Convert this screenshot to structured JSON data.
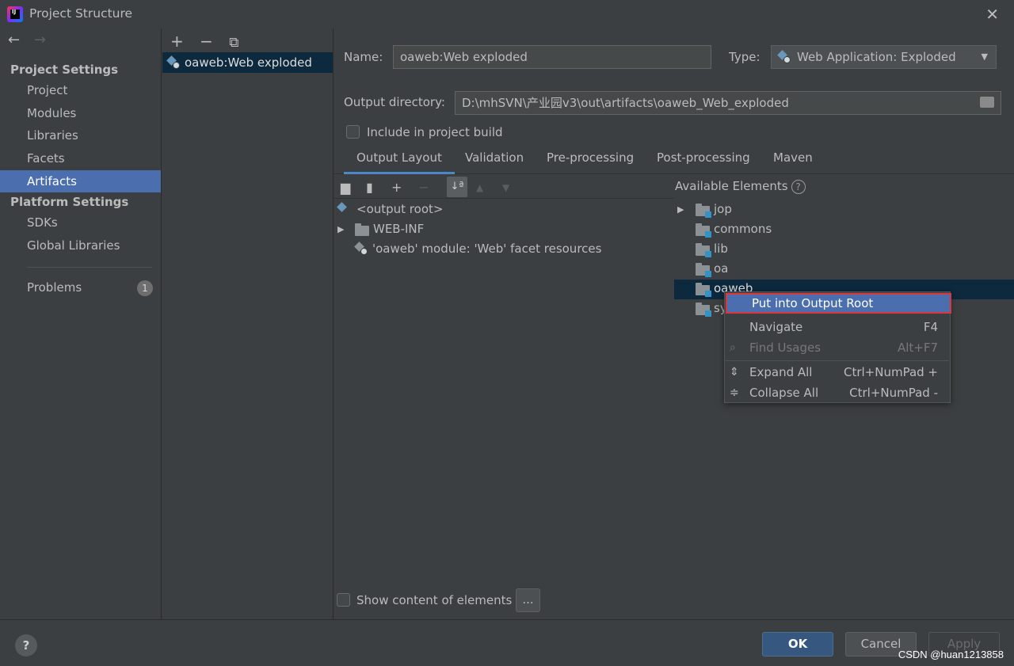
{
  "window": {
    "title": "Project Structure",
    "close": "✕"
  },
  "nav": {
    "back": "←",
    "forward": "→",
    "group_project": "Project Settings",
    "items_project": [
      "Project",
      "Modules",
      "Libraries",
      "Facets",
      "Artifacts"
    ],
    "group_platform": "Platform Settings",
    "items_platform": [
      "SDKs",
      "Global Libraries"
    ],
    "problems": "Problems",
    "problems_count": "1",
    "selected": "Artifacts"
  },
  "artifacts": {
    "toolbar": {
      "add": "+",
      "remove": "−",
      "copy": "⧉"
    },
    "items": [
      "oaweb:Web exploded"
    ]
  },
  "form": {
    "name_label": "Name:",
    "name_value": "oaweb:Web exploded",
    "type_label": "Type:",
    "type_value": "Web Application: Exploded",
    "output_label": "Output directory:",
    "output_value": "D:\\mhSVN\\产业园v3\\out\\artifacts\\oaweb_Web_exploded",
    "include_label": "Include in project build",
    "include_checked": false
  },
  "tabs": [
    "Output Layout",
    "Validation",
    "Pre-processing",
    "Post-processing",
    "Maven"
  ],
  "active_tab": "Output Layout",
  "layout_tree": {
    "rows": [
      "<output root>",
      "WEB-INF",
      "'oaweb' module: 'Web' facet resources"
    ]
  },
  "available": {
    "title": "Available Elements",
    "help": "?",
    "rows": [
      "jop",
      "commons",
      "lib",
      "oa",
      "oaweb",
      "sy"
    ]
  },
  "context_menu": {
    "items": [
      {
        "label": "Put into Output Root",
        "shortcut": ""
      },
      {
        "label": "Navigate",
        "shortcut": "F4"
      },
      {
        "label": "Find Usages",
        "shortcut": "Alt+F7"
      },
      {
        "label": "Expand All",
        "shortcut": "Ctrl+NumPad +"
      },
      {
        "label": "Collapse All",
        "shortcut": "Ctrl+NumPad -"
      }
    ]
  },
  "show_content_label": "Show content of elements",
  "ellipsis": "...",
  "buttons": {
    "help": "?",
    "ok": "OK",
    "cancel": "Cancel",
    "apply": "Apply"
  },
  "watermark": "CSDN @huan1213858",
  "colors": {
    "background": "#3c3f41",
    "selection": "#4b6eaf",
    "tree_selection": "#0d293e",
    "accent_tab": "#4a88c7"
  }
}
